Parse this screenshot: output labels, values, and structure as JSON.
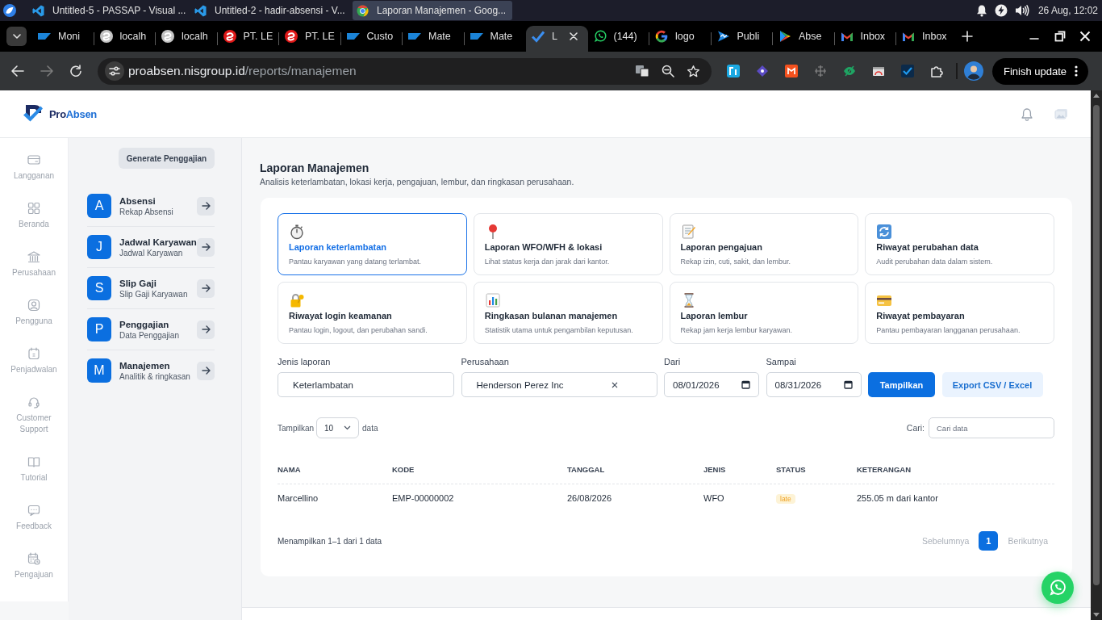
{
  "os_bar": {
    "windows": [
      {
        "title": "Untitled-5 - PASSAP - Visual ...",
        "kind": "editor",
        "selected": false
      },
      {
        "title": "Untitled-2 - hadir-absensi - V...",
        "kind": "editor",
        "selected": false
      },
      {
        "title": "Laporan Manajemen - Goog...",
        "kind": "browser",
        "selected": true
      }
    ],
    "clock": "26 Aug, 12:02"
  },
  "browser": {
    "tabs": [
      {
        "title": "Moni",
        "kind": "sap",
        "selected": false
      },
      {
        "title": "localh",
        "kind": "swirl",
        "selected": false
      },
      {
        "title": "localh",
        "kind": "swirl",
        "selected": false
      },
      {
        "title": "PT. LE",
        "kind": "red-swirl",
        "selected": false
      },
      {
        "title": "PT. LE",
        "kind": "red-swirl",
        "selected": false
      },
      {
        "title": "Custo",
        "kind": "sap",
        "selected": false
      },
      {
        "title": "Mate",
        "kind": "sap",
        "selected": false
      },
      {
        "title": "Mate",
        "kind": "sap",
        "selected": false
      },
      {
        "title": "L",
        "kind": "check",
        "selected": true
      },
      {
        "title": "(144)",
        "kind": "whatsapp",
        "selected": false
      },
      {
        "title": "logo",
        "kind": "google",
        "selected": false
      },
      {
        "title": "Publi",
        "kind": "wave",
        "selected": false
      },
      {
        "title": "Abse",
        "kind": "play",
        "selected": false
      },
      {
        "title": "Inbox",
        "kind": "gmail",
        "selected": false
      },
      {
        "title": "Inbox",
        "kind": "gmail",
        "selected": false
      }
    ],
    "address": {
      "host": "proabsen.nisgroup.id",
      "path": "/reports/manajemen"
    },
    "update_button": "Finish update"
  },
  "page": {
    "brand": {
      "first": "Pro",
      "second": "Absen"
    },
    "nav": [
      {
        "label": "Langganan",
        "kind": "card"
      },
      {
        "label": "Beranda",
        "kind": "grid"
      },
      {
        "label": "Perusahaan",
        "kind": "bank"
      },
      {
        "label": "Pengguna",
        "kind": "user"
      },
      {
        "label": "Penjadwalan",
        "kind": "calendar"
      },
      {
        "label": "Customer Support",
        "kind": "headset"
      },
      {
        "label": "Tutorial",
        "kind": "book"
      },
      {
        "label": "Feedback",
        "kind": "chat"
      },
      {
        "label": "Pengajuan",
        "kind": "calendar-clock"
      }
    ],
    "submenu": {
      "button": "Generate Penggajian",
      "items": [
        {
          "letter": "A",
          "title": "Absensi",
          "subtitle": "Rekap Absensi"
        },
        {
          "letter": "J",
          "title": "Jadwal Karyawan",
          "subtitle": "Jadwal Karyawan"
        },
        {
          "letter": "S",
          "title": "Slip Gaji",
          "subtitle": "Slip Gaji Karyawan"
        },
        {
          "letter": "P",
          "title": "Penggajian",
          "subtitle": "Data Penggajian"
        },
        {
          "letter": "M",
          "title": "Manajemen",
          "subtitle": "Analitik & ringkasan"
        }
      ]
    },
    "report": {
      "title": "Laporan Manajemen",
      "subtitle": "Analisis keterlambatan, lokasi kerja, pengajuan, lembur, dan ringkasan perusahaan.",
      "cards": [
        {
          "kind": "stopwatch",
          "title": "Laporan keterlambatan",
          "description": "Pantau karyawan yang datang terlambat.",
          "selected": true
        },
        {
          "kind": "pin",
          "title": "Laporan WFO/WFH & lokasi",
          "description": "Lihat status kerja dan jarak dari kantor.",
          "selected": false
        },
        {
          "kind": "memo",
          "title": "Laporan pengajuan",
          "description": "Rekap izin, cuti, sakit, dan lembur.",
          "selected": false
        },
        {
          "kind": "arrows",
          "title": "Riwayat perubahan data",
          "description": "Audit perubahan data dalam sistem.",
          "selected": false
        },
        {
          "kind": "lock",
          "title": "Riwayat login keamanan",
          "description": "Pantau login, logout, dan perubahan sandi.",
          "selected": false
        },
        {
          "kind": "chart",
          "title": "Ringkasan bulanan manajemen",
          "description": "Statistik utama untuk pengambilan keputusan.",
          "selected": false
        },
        {
          "kind": "hourglass",
          "title": "Laporan lembur",
          "description": "Rekap jam kerja lembur karyawan.",
          "selected": false
        },
        {
          "kind": "card",
          "title": "Riwayat pembayaran",
          "description": "Pantau pembayaran langganan perusahaan.",
          "selected": false
        }
      ],
      "filters": [
        {
          "label": "Jenis laporan",
          "value": "Keterlambatan",
          "kind": "select"
        },
        {
          "label": "Perusahaan",
          "value": "Henderson Perez Inc",
          "kind": "clearable"
        },
        {
          "label": "Dari",
          "value": "08/01/2026",
          "kind": "date"
        },
        {
          "label": "Sampai",
          "value": "08/31/2026",
          "kind": "date"
        }
      ],
      "actions": [
        {
          "label": "Tampilkan",
          "kind": "primary"
        },
        {
          "label": "Export CSV / Excel",
          "kind": "secondary"
        }
      ],
      "page_size": {
        "label": "Tampilkan",
        "value": "10",
        "suffix": "data"
      },
      "search": {
        "label": "Cari:",
        "placeholder": "Cari data"
      },
      "table": {
        "columns": [
          {
            "label": "NAMA",
            "kind": "text"
          },
          {
            "label": "KODE",
            "kind": "text"
          },
          {
            "label": "TANGGAL",
            "kind": "text"
          },
          {
            "label": "JENIS",
            "kind": "text"
          },
          {
            "label": "STATUS",
            "kind": "badge"
          },
          {
            "label": "KETERANGAN",
            "kind": "text"
          }
        ],
        "rows": [
          {
            "cells": [
              "Marcellino",
              "EMP-00000002",
              "26/08/2026",
              "WFO",
              "late",
              "255.05 m dari kantor"
            ]
          }
        ]
      },
      "summary": "Menampilkan 1–1 dari 1 data",
      "pagination": {
        "previous": {
          "label": "Sebelumnya",
          "disabled": true
        },
        "pages": [
          {
            "label": "1",
            "selected": true
          }
        ],
        "next": {
          "label": "Berikutnya",
          "disabled": true
        }
      }
    }
  }
}
